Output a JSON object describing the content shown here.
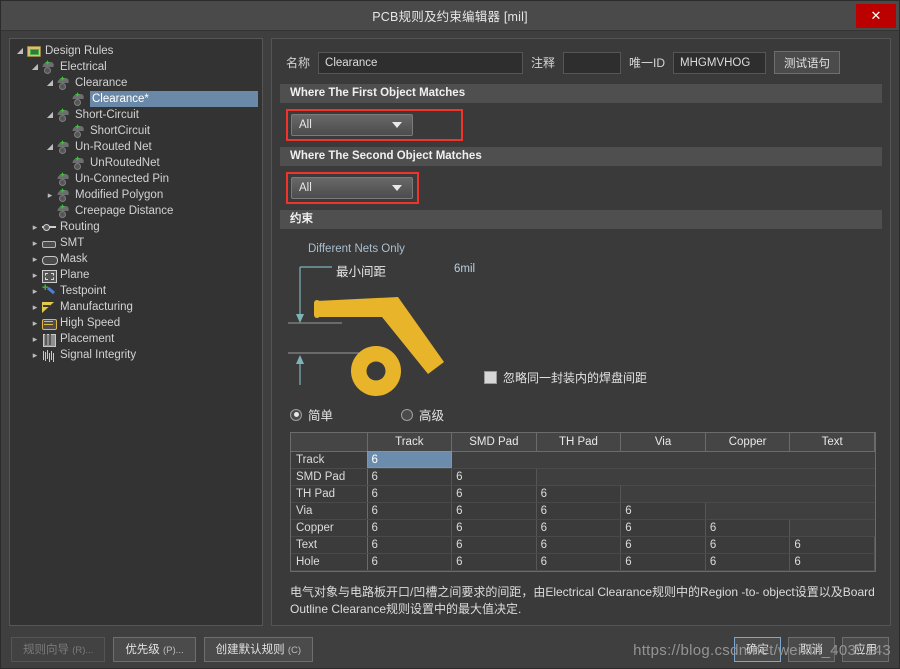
{
  "window": {
    "title": "PCB规则及约束编辑器 [mil]",
    "close_label": "✕"
  },
  "tree": {
    "items": [
      {
        "label": "Design Rules",
        "indent": 0,
        "arrow": "open",
        "icon": "folder-icon",
        "selected": false
      },
      {
        "label": "Electrical",
        "indent": 1,
        "arrow": "open",
        "icon": "electrical-rule-icon",
        "selected": false
      },
      {
        "label": "Clearance",
        "indent": 2,
        "arrow": "open",
        "icon": "electrical-rule-icon",
        "selected": false
      },
      {
        "label": "Clearance*",
        "indent": 3,
        "arrow": "none",
        "icon": "electrical-rule-icon",
        "selected": true
      },
      {
        "label": "Short-Circuit",
        "indent": 2,
        "arrow": "open",
        "icon": "electrical-rule-icon",
        "selected": false
      },
      {
        "label": "ShortCircuit",
        "indent": 3,
        "arrow": "none",
        "icon": "electrical-rule-icon",
        "selected": false
      },
      {
        "label": "Un-Routed Net",
        "indent": 2,
        "arrow": "open",
        "icon": "electrical-rule-icon",
        "selected": false
      },
      {
        "label": "UnRoutedNet",
        "indent": 3,
        "arrow": "none",
        "icon": "electrical-rule-icon",
        "selected": false
      },
      {
        "label": "Un-Connected Pin",
        "indent": 2,
        "arrow": "none",
        "icon": "electrical-rule-icon",
        "selected": false
      },
      {
        "label": "Modified Polygon",
        "indent": 2,
        "arrow": "closed",
        "icon": "electrical-rule-icon",
        "selected": false
      },
      {
        "label": "Creepage Distance",
        "indent": 2,
        "arrow": "none",
        "icon": "electrical-rule-icon",
        "selected": false
      },
      {
        "label": "Routing",
        "indent": 1,
        "arrow": "closed",
        "icon": "routing-icon",
        "selected": false
      },
      {
        "label": "SMT",
        "indent": 1,
        "arrow": "closed",
        "icon": "smt-icon",
        "selected": false
      },
      {
        "label": "Mask",
        "indent": 1,
        "arrow": "closed",
        "icon": "mask-icon",
        "selected": false
      },
      {
        "label": "Plane",
        "indent": 1,
        "arrow": "closed",
        "icon": "plane-icon",
        "selected": false
      },
      {
        "label": "Testpoint",
        "indent": 1,
        "arrow": "closed",
        "icon": "testpoint-icon",
        "selected": false
      },
      {
        "label": "Manufacturing",
        "indent": 1,
        "arrow": "closed",
        "icon": "manufacturing-icon",
        "selected": false
      },
      {
        "label": "High Speed",
        "indent": 1,
        "arrow": "closed",
        "icon": "high-speed-icon",
        "selected": false
      },
      {
        "label": "Placement",
        "indent": 1,
        "arrow": "closed",
        "icon": "placement-icon",
        "selected": false
      },
      {
        "label": "Signal Integrity",
        "indent": 1,
        "arrow": "closed",
        "icon": "signal-integrity-icon",
        "selected": false
      }
    ]
  },
  "form": {
    "name_label": "名称",
    "name_value": "Clearance",
    "comment_label": "注释",
    "comment_value": "",
    "uid_label": "唯一ID",
    "uid_value": "MHGMVHOG",
    "test_button": "测试语句"
  },
  "first_match": {
    "header": "Where The First Object Matches",
    "selected": "All"
  },
  "second_match": {
    "header": "Where The Second Object Matches",
    "selected": "All"
  },
  "constraint": {
    "header": "约束",
    "nets_label": "Different Nets Only",
    "min_clearance_label": "最小间距",
    "min_clearance_value": "6mil",
    "ignore_pad_label": "忽略同一封装内的焊盘间距",
    "ignore_pad_checked": false,
    "mode_simple": "简单",
    "mode_advanced": "高级",
    "mode_selected": "简单",
    "trace_color": "#e8b429",
    "arrow_color": "#7fb3b8"
  },
  "matrix": {
    "columns": [
      "Track",
      "SMD Pad",
      "TH Pad",
      "Via",
      "Copper",
      "Text"
    ],
    "rows": [
      {
        "name": "Track",
        "values": [
          "6"
        ]
      },
      {
        "name": "SMD Pad",
        "values": [
          "6",
          "6"
        ]
      },
      {
        "name": "TH Pad",
        "values": [
          "6",
          "6",
          "6"
        ]
      },
      {
        "name": "Via",
        "values": [
          "6",
          "6",
          "6",
          "6"
        ]
      },
      {
        "name": "Copper",
        "values": [
          "6",
          "6",
          "6",
          "6",
          "6"
        ]
      },
      {
        "name": "Text",
        "values": [
          "6",
          "6",
          "6",
          "6",
          "6",
          "6"
        ]
      },
      {
        "name": "Hole",
        "values": [
          "6",
          "6",
          "6",
          "6",
          "6",
          "6"
        ]
      }
    ],
    "selected_cell": {
      "row": 0,
      "col": 0
    },
    "selected_color": "#6b8cad"
  },
  "description": "电气对象与电路板开口/凹槽之间要求的间距，由Electrical Clearance规则中的Region -to- object设置以及Board Outline Clearance规则设置中的最大值决定.",
  "footer": {
    "rule_wizard": "规则向导",
    "rule_wizard_key": "(R)...",
    "priority": "优先级",
    "priority_key": "(P)...",
    "create_default": "创建默认规则",
    "create_default_key": "(C)",
    "ok": "确定",
    "cancel": "取消",
    "apply": "应用"
  },
  "watermark": "https://blog.csdn.net/weixin_403..143"
}
